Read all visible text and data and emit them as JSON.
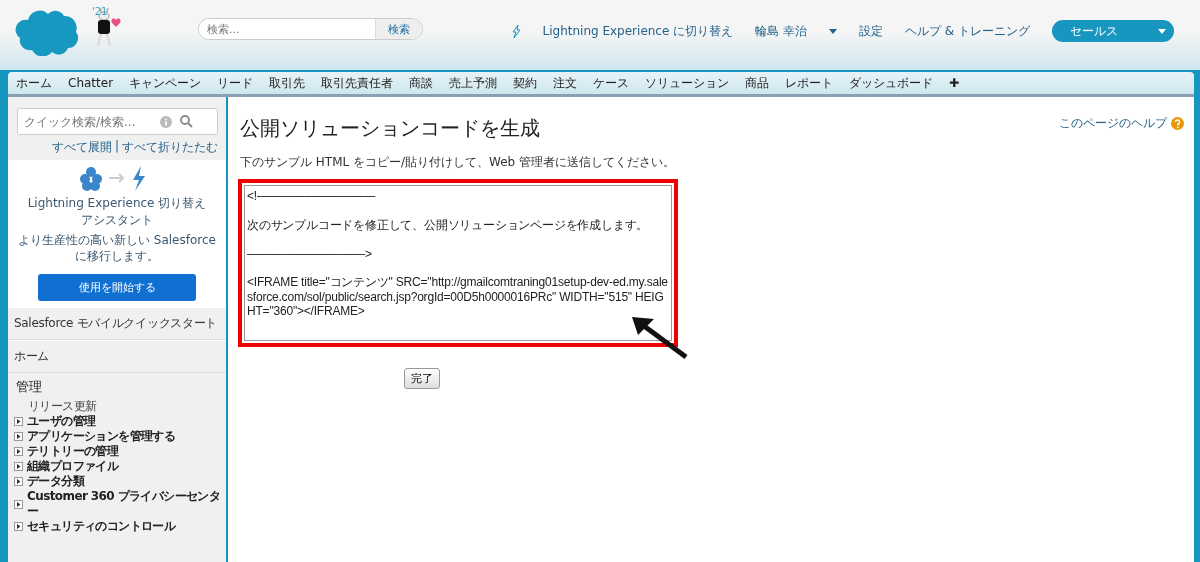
{
  "header": {
    "badge": "'21",
    "search": {
      "placeholder": "検索...",
      "button": "検索"
    },
    "links": [
      "Lightning Experience に切り替え",
      "輪島 幸治",
      "設定",
      "ヘルプ & トレーニング"
    ],
    "app_menu": "セールス"
  },
  "tabs": [
    {
      "label": "ホーム"
    },
    {
      "label": "Chatter"
    },
    {
      "label": "キャンペーン"
    },
    {
      "label": "リード"
    },
    {
      "label": "取引先"
    },
    {
      "label": "取引先責任者"
    },
    {
      "label": "商談"
    },
    {
      "label": "売上予測"
    },
    {
      "label": "契約"
    },
    {
      "label": "注文"
    },
    {
      "label": "ケース"
    },
    {
      "label": "ソリューション"
    },
    {
      "label": "商品"
    },
    {
      "label": "レポート"
    },
    {
      "label": "ダッシュボード"
    },
    {
      "label": "✚"
    }
  ],
  "sidebar": {
    "quick_find": {
      "placeholder": "クイック検索/検索..."
    },
    "expand_all": "すべて展開",
    "separator": "|",
    "collapse_all": "すべて折りたたむ",
    "promo": {
      "title": "Lightning Experience 切り替えアシスタント",
      "text": "より生産性の高い新しい Salesforce に移行します。",
      "button": "使用を開始する"
    },
    "sections": [
      {
        "title": "Salesforce モバイルクイックスタート"
      },
      {
        "title": "ホーム"
      }
    ],
    "admin": {
      "title": "管理",
      "items": [
        {
          "label": "リリース更新",
          "kind": "link"
        },
        {
          "label": "ユーザの管理",
          "kind": "folder",
          "expanded": false
        },
        {
          "label": "アプリケーションを管理する",
          "kind": "folder",
          "expanded": false
        },
        {
          "label": "テリトリーの管理",
          "kind": "folder",
          "expanded": false
        },
        {
          "label": "組織プロファイル",
          "kind": "folder",
          "expanded": false
        },
        {
          "label": "データ分類",
          "kind": "folder",
          "expanded": false
        },
        {
          "label": "Customer 360 プライバシーセンター",
          "kind": "folder",
          "expanded": false
        },
        {
          "label": "セキュリティのコントロール",
          "kind": "folder",
          "expanded": false
        }
      ]
    }
  },
  "main": {
    "title": "公開ソリューションコードを生成",
    "help": "このページのヘルプ",
    "instruction": "下のサンプル HTML をコピー/貼り付けして、Web 管理者に送信してください。",
    "code": "<!——————————\n\n次のサンプルコードを修正して、公開ソリューションページを作成します。\n\n——————————>\n\n<IFRAME title=\"コンテンツ\" SRC=\"http://gmailcomtraning01setup-dev-ed.my.salesforce.com/sol/public/search.jsp?orgId=00D5h0000016PRc\" WIDTH=\"515\" HEIGHT=\"360\"></IFRAME>",
    "done_button": "完了"
  }
}
